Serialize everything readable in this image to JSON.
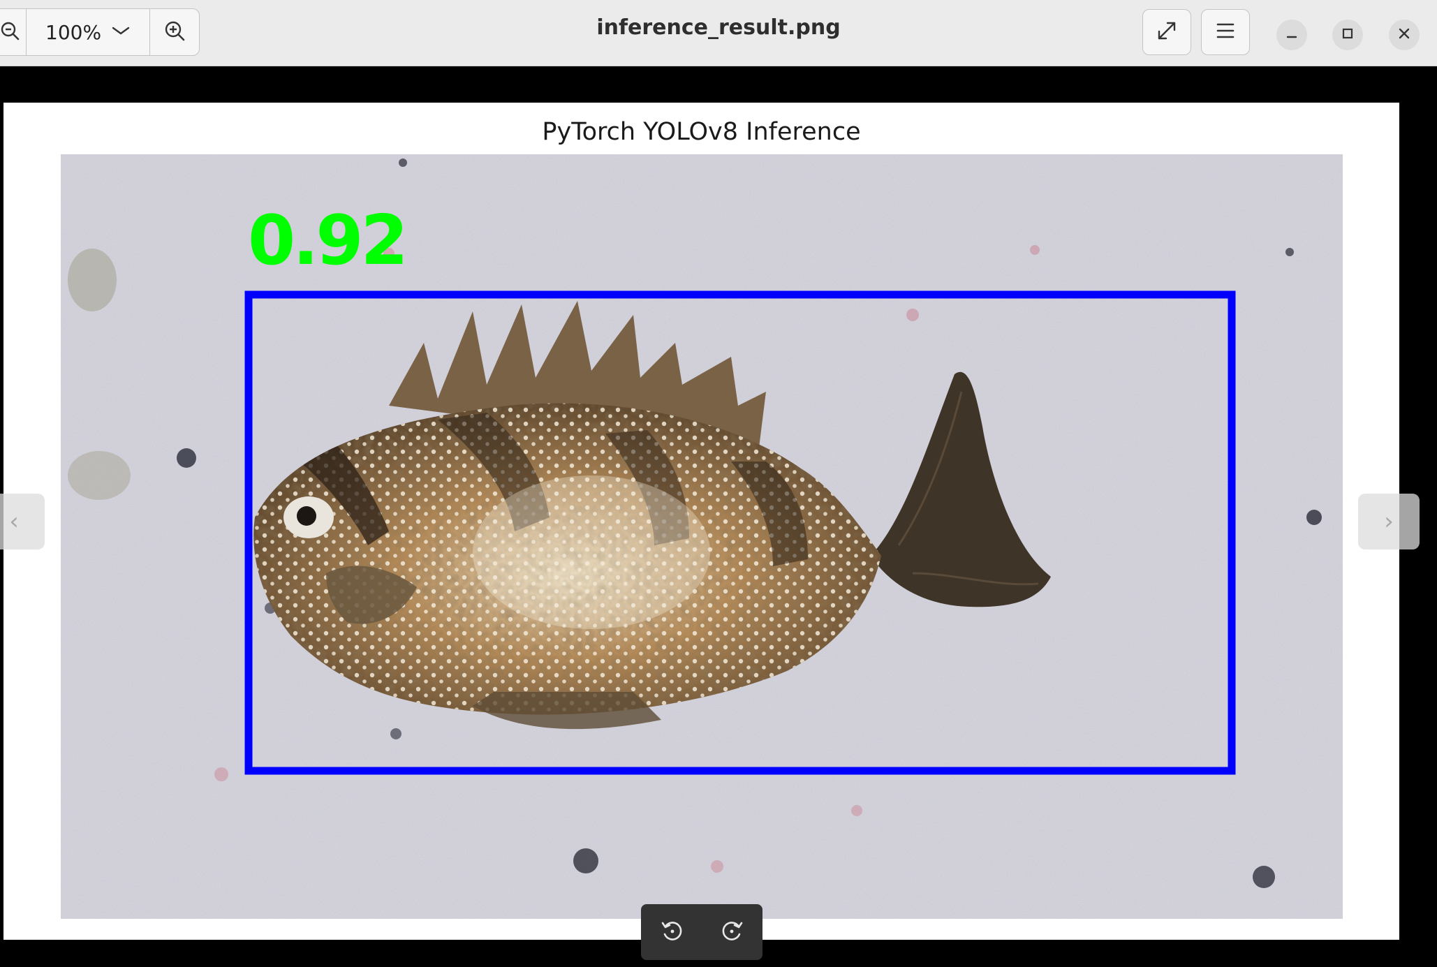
{
  "window": {
    "title": "inference_result.png"
  },
  "toolbar": {
    "zoom_level": "100%",
    "icons": {
      "zoom_out": "zoom-out-icon",
      "zoom_dropdown": "chevron-down-icon",
      "zoom_in": "zoom-in-icon",
      "fullscreen": "fullscreen-icon",
      "menu": "hamburger-menu-icon",
      "minimize": "minimize-icon",
      "maximize": "maximize-icon",
      "close": "close-icon"
    }
  },
  "image": {
    "plot_title": "PyTorch YOLOv8 Inference",
    "detection": {
      "confidence": "0.92",
      "box_color": "#0000ff",
      "label_color": "#00ff00"
    }
  },
  "navigation": {
    "previous": "‹",
    "next": "›"
  },
  "rotate_controls": {
    "icons": {
      "rotate_left": "rotate-left-icon",
      "rotate_right": "rotate-right-icon"
    }
  },
  "colors": {
    "header_bg": "#ebebeb",
    "viewer_bg": "#000000",
    "canvas_bg": "#ffffff",
    "overlay_bar": "#333333"
  }
}
